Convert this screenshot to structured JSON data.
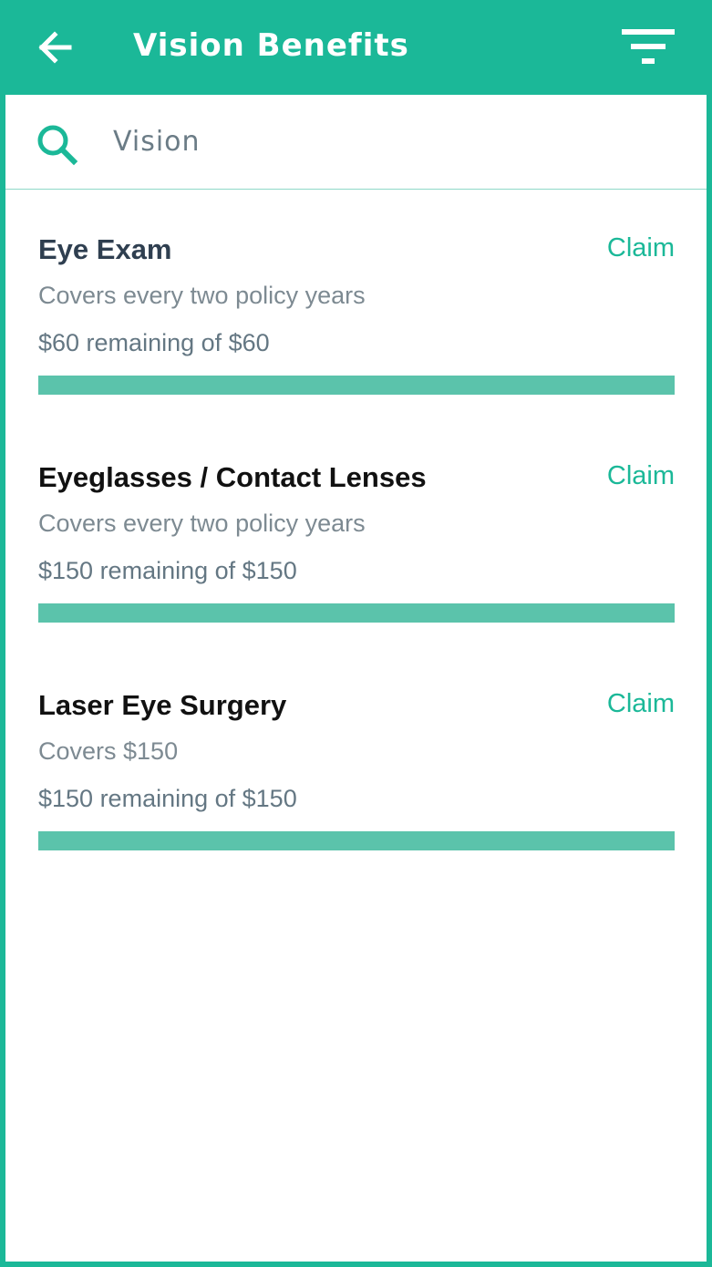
{
  "header": {
    "title": "Vision Benefits",
    "back_icon": "arrow-left-icon",
    "filter_icon": "filter-icon"
  },
  "search": {
    "icon": "search-icon",
    "value": "Vision",
    "placeholder": ""
  },
  "benefits": [
    {
      "title": "Eye Exam",
      "claim_label": "Claim",
      "coverage": "Covers every two policy years",
      "remaining_text": "$60 remaining of $60",
      "remaining_fraction": 1.0
    },
    {
      "title": "Eyeglasses / Contact Lenses",
      "claim_label": "Claim",
      "coverage": "Covers every two policy years",
      "remaining_text": "$150 remaining of $150",
      "remaining_fraction": 1.0
    },
    {
      "title": "Laser Eye Surgery",
      "claim_label": "Claim",
      "coverage": "Covers $150",
      "remaining_text": "$150 remaining of $150",
      "remaining_fraction": 1.0
    }
  ],
  "colors": {
    "accent": "#1bb898",
    "progress": "#5bc3ab",
    "white": "#ffffff"
  }
}
